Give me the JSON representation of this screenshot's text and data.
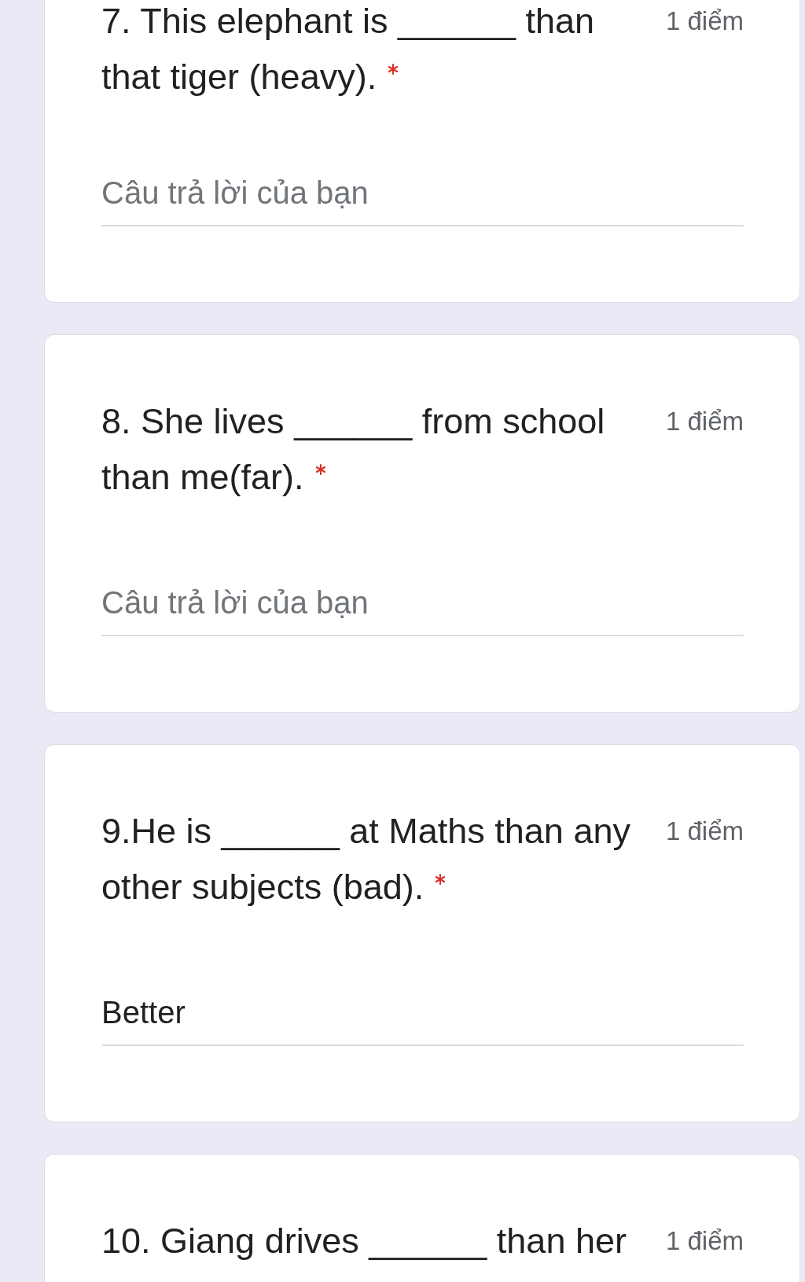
{
  "questions": [
    {
      "text": "7. This elephant is ______ than that tiger (heavy).",
      "required": true,
      "points": "1 điểm",
      "answer": {
        "placeholder": "Câu trả lời của bạn"
      }
    },
    {
      "text": "8. She lives ______ from school than me(far).",
      "required": true,
      "points": "1 điểm",
      "answer": {
        "placeholder": "Câu trả lời của bạn"
      }
    },
    {
      "text": "9.He is ______ at Maths than any other subjects (bad).",
      "required": true,
      "points": "1 điểm",
      "answer": {
        "value": "Better"
      }
    },
    {
      "text": "10. Giang drives ______ than her",
      "points": "1 điểm"
    }
  ]
}
